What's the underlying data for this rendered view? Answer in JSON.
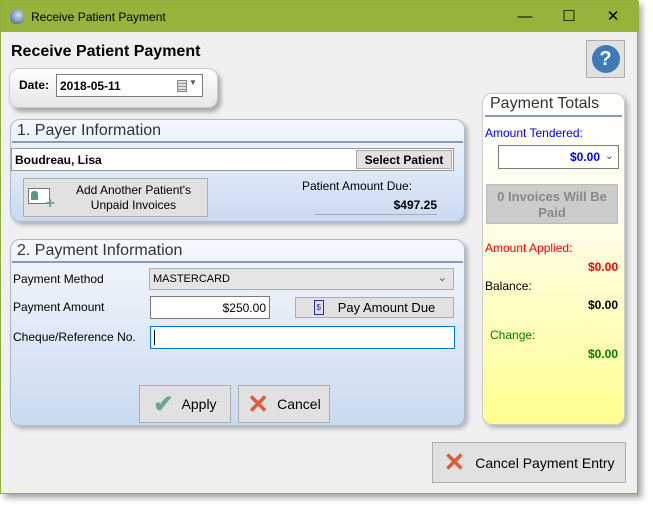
{
  "window": {
    "title": "Receive Patient Payment",
    "minimize": "—",
    "maximize": "☐",
    "close": "✕"
  },
  "heading": "Receive Patient Payment",
  "help_label": "?",
  "date": {
    "label": "Date:",
    "value": "2018-05-11"
  },
  "payer": {
    "title": "1. Payer Information",
    "patient_name": "Boudreau, Lisa",
    "select_patient": "Select Patient",
    "add_another": "Add Another Patient's Unpaid Invoices",
    "amount_due_label": "Patient Amount Due:",
    "amount_due_value": "$497.25"
  },
  "payment": {
    "title": "2. Payment Information",
    "method_label": "Payment Method",
    "method_value": "MASTERCARD",
    "amount_label": "Payment Amount",
    "amount_value": "$250.00",
    "pay_amount_due": "Pay Amount Due",
    "reference_label": "Cheque/Reference No.",
    "reference_value": "",
    "apply": "Apply",
    "cancel": "Cancel"
  },
  "totals": {
    "title": "Payment Totals",
    "tendered_label": "Amount Tendered:",
    "tendered_value": "$0.00",
    "invoices_button": "0 Invoices Will Be Paid",
    "applied_label": "Amount Applied:",
    "applied_value": "$0.00",
    "balance_label": "Balance:",
    "balance_value": "$0.00",
    "change_label": "Change:",
    "change_value": "$0.00"
  },
  "cancel_entry": "Cancel Payment Entry",
  "colors": {
    "titlebar": "#96b43c",
    "tendered": "#0000ff",
    "applied": "#ff0000",
    "change": "#008000",
    "help": "#3d7ab8"
  }
}
